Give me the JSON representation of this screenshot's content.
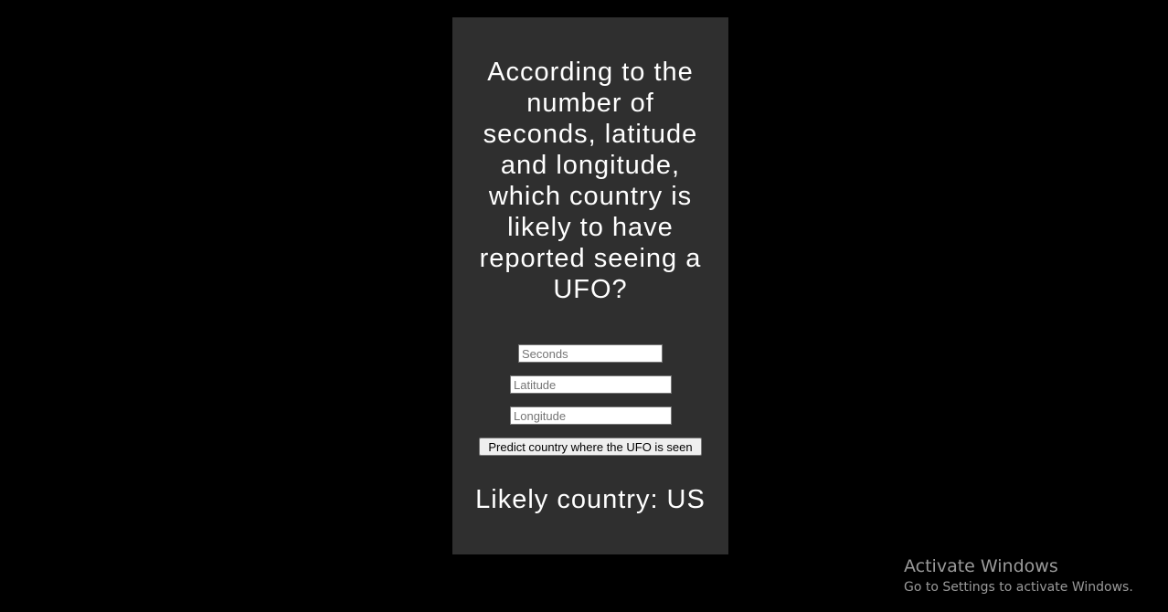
{
  "form": {
    "heading": "According to the number of seconds, latitude and longitude, which country is likely to have reported seeing a UFO?",
    "seconds": {
      "placeholder": "Seconds",
      "value": ""
    },
    "latitude": {
      "placeholder": "Latitude",
      "value": ""
    },
    "longitude": {
      "placeholder": "Longitude",
      "value": ""
    },
    "submit_label": "Predict country where the UFO is seen",
    "result_text": "Likely country: US"
  },
  "watermark": {
    "title": "Activate Windows",
    "subtitle": "Go to Settings to activate Windows."
  },
  "colors": {
    "page_background": "#000000",
    "card_background": "#2f2f2f",
    "text": "#ffffff"
  }
}
